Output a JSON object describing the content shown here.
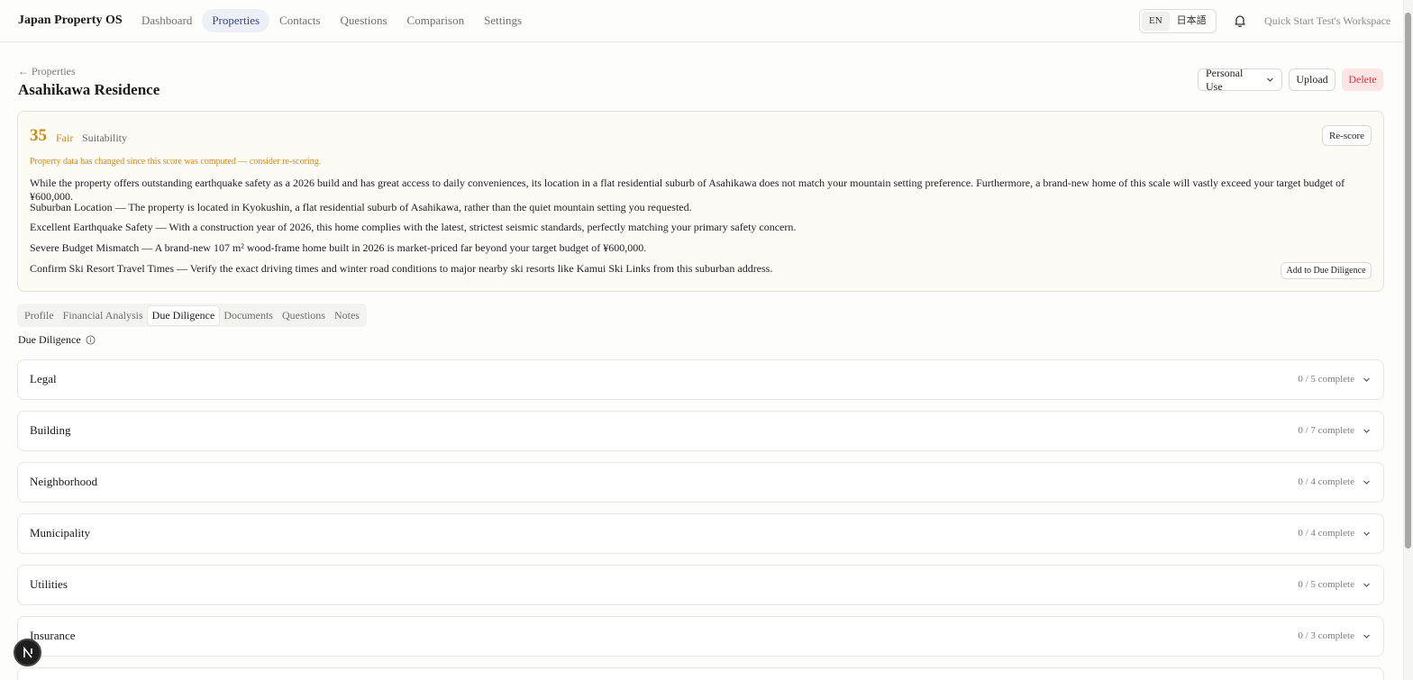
{
  "app": {
    "brand": "Japan Property OS"
  },
  "nav": {
    "items": [
      {
        "label": "Dashboard",
        "active": false
      },
      {
        "label": "Properties",
        "active": true
      },
      {
        "label": "Contacts",
        "active": false
      },
      {
        "label": "Questions",
        "active": false
      },
      {
        "label": "Comparison",
        "active": false
      },
      {
        "label": "Settings",
        "active": false
      }
    ]
  },
  "lang": {
    "en": "EN",
    "ja": "日本語",
    "selected": "EN"
  },
  "workspace": "Quick Start Test's Workspace",
  "breadcrumb": {
    "back": "← Properties"
  },
  "property": {
    "title": "Asahikawa Residence"
  },
  "actions": {
    "use_select": "Personal Use",
    "upload": "Upload",
    "delete": "Delete"
  },
  "score": {
    "value": "35",
    "rating": "Fair",
    "label": "Suitability",
    "rescore": "Re-score",
    "warning": "Property data has changed since this score was computed — consider re-scoring.",
    "summary": "While the property offers outstanding earthquake safety as a 2026 build and has great access to daily conveniences, its location in a flat residential suburb of Asahikawa does not match your mountain setting preference. Furthermore, a brand-new home of this scale will vastly exceed your target budget of ¥600,000.",
    "points": [
      "Suburban Location — The property is located in Kyokushin, a flat residential suburb of Asahikawa, rather than the quiet mountain setting you requested.",
      "Excellent Earthquake Safety — With a construction year of 2026, this home complies with the latest, strictest seismic standards, perfectly matching your primary safety concern.",
      "Severe Budget Mismatch — A brand-new 107 m² wood-frame home built in 2026 is market-priced far beyond your target budget of ¥600,000.",
      "Confirm Ski Resort Travel Times — Verify the exact driving times and winter road conditions to major nearby ski resorts like Kamui Ski Links from this suburban address."
    ],
    "add_dd": "Add to Due Diligence"
  },
  "tabs": [
    {
      "label": "Profile",
      "active": false
    },
    {
      "label": "Financial Analysis",
      "active": false
    },
    {
      "label": "Due Diligence",
      "active": true
    },
    {
      "label": "Documents",
      "active": false
    },
    {
      "label": "Questions",
      "active": false
    },
    {
      "label": "Notes",
      "active": false
    }
  ],
  "due_diligence": {
    "label": "Due Diligence",
    "sections": [
      {
        "title": "Legal",
        "progress": "0 / 5 complete"
      },
      {
        "title": "Building",
        "progress": "0 / 7 complete"
      },
      {
        "title": "Neighborhood",
        "progress": "0 / 4 complete"
      },
      {
        "title": "Municipality",
        "progress": "0 / 4 complete"
      },
      {
        "title": "Utilities",
        "progress": "0 / 5 complete"
      },
      {
        "title": "Insurance",
        "progress": "0 / 3 complete"
      }
    ]
  },
  "colors": {
    "accent": "#3b4a86",
    "score": "#c98a1e",
    "danger": "#d23a3a"
  }
}
